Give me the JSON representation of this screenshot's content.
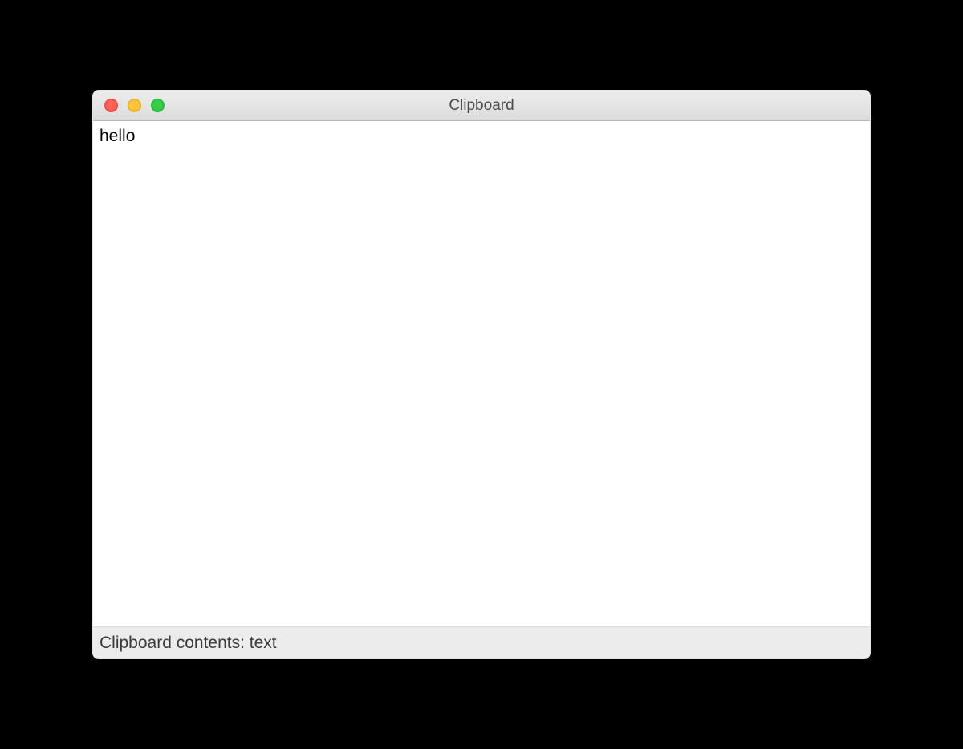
{
  "window": {
    "title": "Clipboard"
  },
  "content": {
    "text": "hello"
  },
  "status": {
    "label": "Clipboard contents: text"
  }
}
